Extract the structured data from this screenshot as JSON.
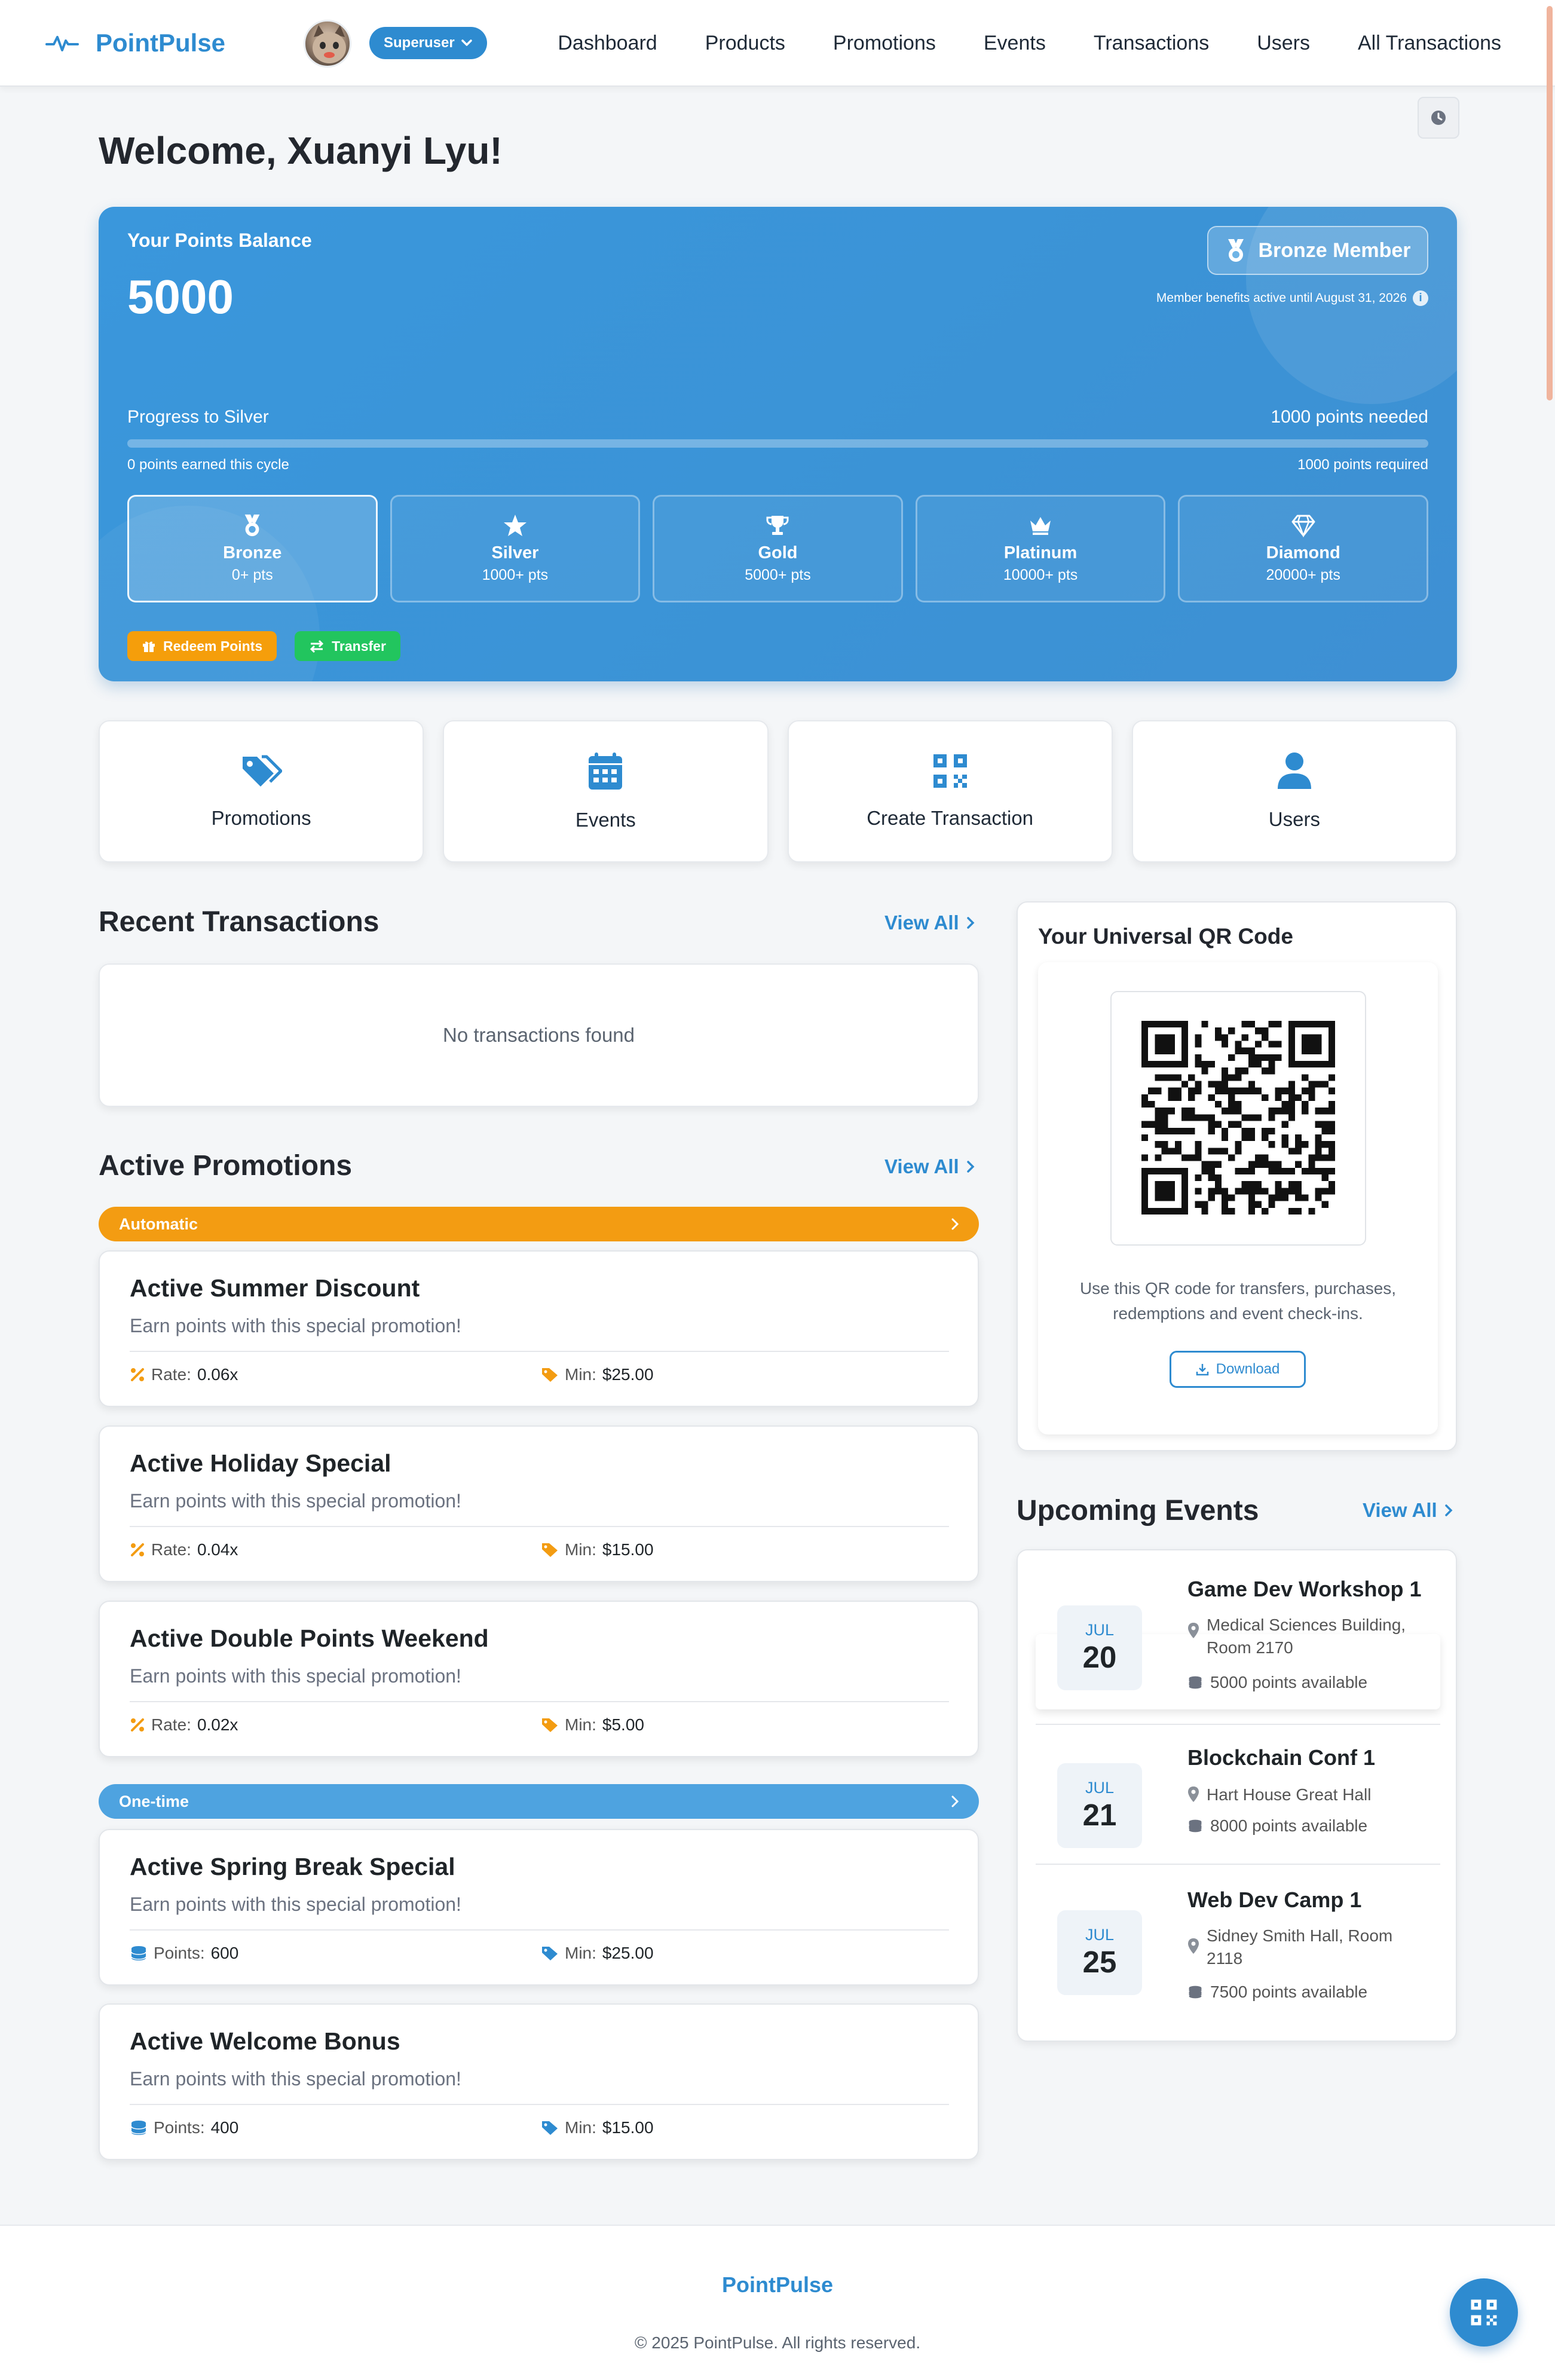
{
  "nav": {
    "brand": "PointPulse",
    "role": "Superuser",
    "links": [
      "Dashboard",
      "Products",
      "Promotions",
      "Events",
      "Transactions",
      "Users",
      "All Transactions"
    ]
  },
  "welcome": "Welcome, Xuanyi Lyu!",
  "points": {
    "label": "Your Points Balance",
    "balance": "5000",
    "tier_badge": "Bronze Member",
    "benefits": "Member benefits active until August 31, 2026",
    "progress_label": "Progress to Silver",
    "progress_needed": "1000 points needed",
    "progress_fraction": 0,
    "cycle_earned": "0 points earned this cycle",
    "cycle_required": "1000 points required",
    "tiers": [
      {
        "name": "Bronze",
        "pts": "0+ pts",
        "icon": "medal-icon",
        "current": true
      },
      {
        "name": "Silver",
        "pts": "1000+ pts",
        "icon": "star-icon",
        "current": false
      },
      {
        "name": "Gold",
        "pts": "5000+ pts",
        "icon": "trophy-icon",
        "current": false
      },
      {
        "name": "Platinum",
        "pts": "10000+ pts",
        "icon": "crown-icon",
        "current": false
      },
      {
        "name": "Diamond",
        "pts": "20000+ pts",
        "icon": "diamond-icon",
        "current": false
      }
    ],
    "redeem_label": "Redeem Points",
    "transfer_label": "Transfer"
  },
  "quick": [
    {
      "label": "Promotions",
      "icon": "tags-icon"
    },
    {
      "label": "Events",
      "icon": "calendar-icon"
    },
    {
      "label": "Create Transaction",
      "icon": "qrcode-icon"
    },
    {
      "label": "Users",
      "icon": "user-icon"
    }
  ],
  "recent": {
    "title": "Recent Transactions",
    "view_all": "View All",
    "empty": "No transactions found"
  },
  "promotions": {
    "title": "Active Promotions",
    "view_all": "View All",
    "automatic_label": "Automatic",
    "onetime_label": "One-time",
    "automatic": [
      {
        "title": "Active Summer Discount",
        "desc": "Earn points with this special promotion!",
        "rate_label": "Rate:",
        "rate": "0.06x",
        "min_label": "Min:",
        "min": "$25.00"
      },
      {
        "title": "Active Holiday Special",
        "desc": "Earn points with this special promotion!",
        "rate_label": "Rate:",
        "rate": "0.04x",
        "min_label": "Min:",
        "min": "$15.00"
      },
      {
        "title": "Active Double Points Weekend",
        "desc": "Earn points with this special promotion!",
        "rate_label": "Rate:",
        "rate": "0.02x",
        "min_label": "Min:",
        "min": "$5.00"
      }
    ],
    "onetime": [
      {
        "title": "Active Spring Break Special",
        "desc": "Earn points with this special promotion!",
        "points_label": "Points:",
        "points": "600",
        "min_label": "Min:",
        "min": "$25.00"
      },
      {
        "title": "Active Welcome Bonus",
        "desc": "Earn points with this special promotion!",
        "points_label": "Points:",
        "points": "400",
        "min_label": "Min:",
        "min": "$15.00"
      }
    ]
  },
  "qr": {
    "title": "Your Universal QR Code",
    "text": "Use this QR code for transfers, purchases, redemptions and event check-ins.",
    "download": "Download"
  },
  "events": {
    "title": "Upcoming Events",
    "view_all": "View All",
    "items": [
      {
        "month": "JUL",
        "day": "20",
        "title": "Game Dev Workshop 1",
        "location": "Medical Sciences Building, Room 2170",
        "points": "5000 points available"
      },
      {
        "month": "JUL",
        "day": "21",
        "title": "Blockchain Conf 1",
        "location": "Hart House Great Hall",
        "points": "8000 points available"
      },
      {
        "month": "JUL",
        "day": "25",
        "title": "Web Dev Camp 1",
        "location": "Sidney Smith Hall, Room 2118",
        "points": "7500 points available"
      }
    ]
  },
  "footer": {
    "brand": "PointPulse",
    "copyright": "© 2025 PointPulse. All rights reserved."
  },
  "colors": {
    "primary": "#2e8bd0",
    "card_blue": "#3a97dc",
    "automatic": "#f39c12",
    "onetime": "#4ea3e0",
    "redeem": "#f59e0b",
    "transfer": "#22c55e"
  }
}
